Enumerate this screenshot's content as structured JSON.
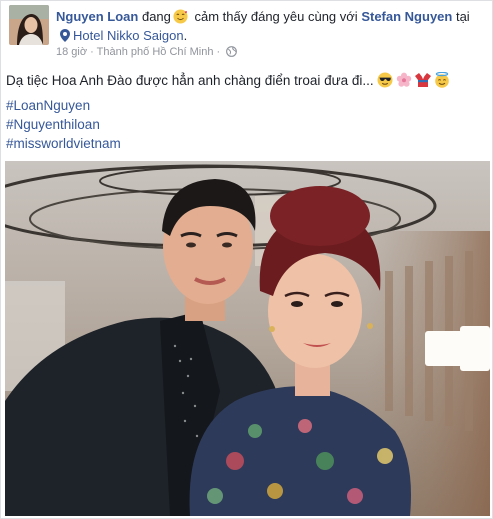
{
  "post": {
    "author": "Nguyen Loan",
    "feeling_prefix": "đang",
    "feeling_text": "cảm thấy đáng yêu cùng với",
    "tagged_friend": "Stefan Nguyen",
    "at_word": "tại",
    "place": "Hotel Nikko Saigon",
    "place_suffix": ".",
    "time": "18 giờ",
    "location": "Thành phố Hồ Chí Minh",
    "separator": "·",
    "privacy_icon": "globe-icon",
    "status_text": "Dạ tiệc Hoa Anh Đào được hẳn anh chàng điển troai đưa đi...",
    "status_emojis": [
      "sunglasses-emoji",
      "cherry-blossom-emoji",
      "kimono-emoji",
      "halo-emoji"
    ],
    "hashtags": [
      "#LoanNguyen",
      "#Nguyenthiloan",
      "#missworldvietnam"
    ],
    "photo_icon": "selfie-photo"
  },
  "colors": {
    "link": "#365899",
    "text": "#1d2129",
    "meta": "#90949c",
    "border": "#dddfe2"
  }
}
